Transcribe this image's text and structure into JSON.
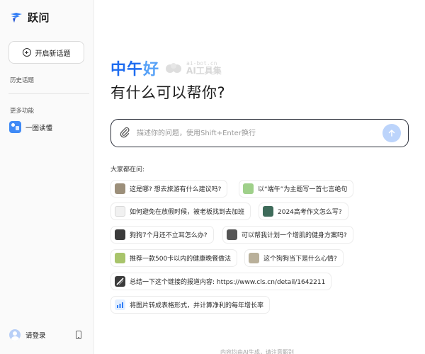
{
  "sidebar": {
    "brand_name": "跃问",
    "new_chat_label": "开启新话题",
    "history_label": "历史话题",
    "more_label": "更多功能",
    "feature_label": "一图读懂",
    "login_label": "请登录"
  },
  "main": {
    "greeting_strong": "中午",
    "greeting_light": "好",
    "subtitle": "有什么可以帮你?",
    "input_placeholder": "描述你的问题，使用Shift+Enter换行",
    "suggest_title": "大家都在问:",
    "footer_note": "内容均由AI生成，请注意甄别"
  },
  "watermark": {
    "url": "ai-bot.cn",
    "name": "AI工具集"
  },
  "suggestions": [
    {
      "text": "这是哪? 想去旅游有什么建议吗?",
      "thumb": "#9c8f7a"
    },
    {
      "text": "以“端午”为主题写一首七言绝句",
      "thumb": "#9fd08a"
    },
    {
      "text": "如何避免在放假时候，被老板找到去加班",
      "thumb": "#f1f1f1"
    },
    {
      "text": "2024高考作文怎么写?",
      "thumb": "#3e6b5a"
    },
    {
      "text": "狗狗7个月还不立耳怎么办?",
      "thumb": "#3b3b3b"
    },
    {
      "text": "可以帮我计划一个增肌的健身方案吗?",
      "thumb": "#555555"
    },
    {
      "text": "推荐一款500卡以内的健康晚餐做法",
      "thumb": "#a8c46b"
    },
    {
      "text": "这个狗狗当下是什么心情?",
      "thumb": "#b9b09a"
    },
    {
      "text": "总结一下这个链接的报道内容: https://www.cls.cn/detail/1642211",
      "thumb": "#3a3a3a"
    },
    {
      "text": "将图片转成表格形式，并计算净利的每年增长率",
      "thumb": "#e3efff"
    }
  ],
  "colors": {
    "accent": "#1e6cf0",
    "send_button": "#bcd4fb"
  }
}
